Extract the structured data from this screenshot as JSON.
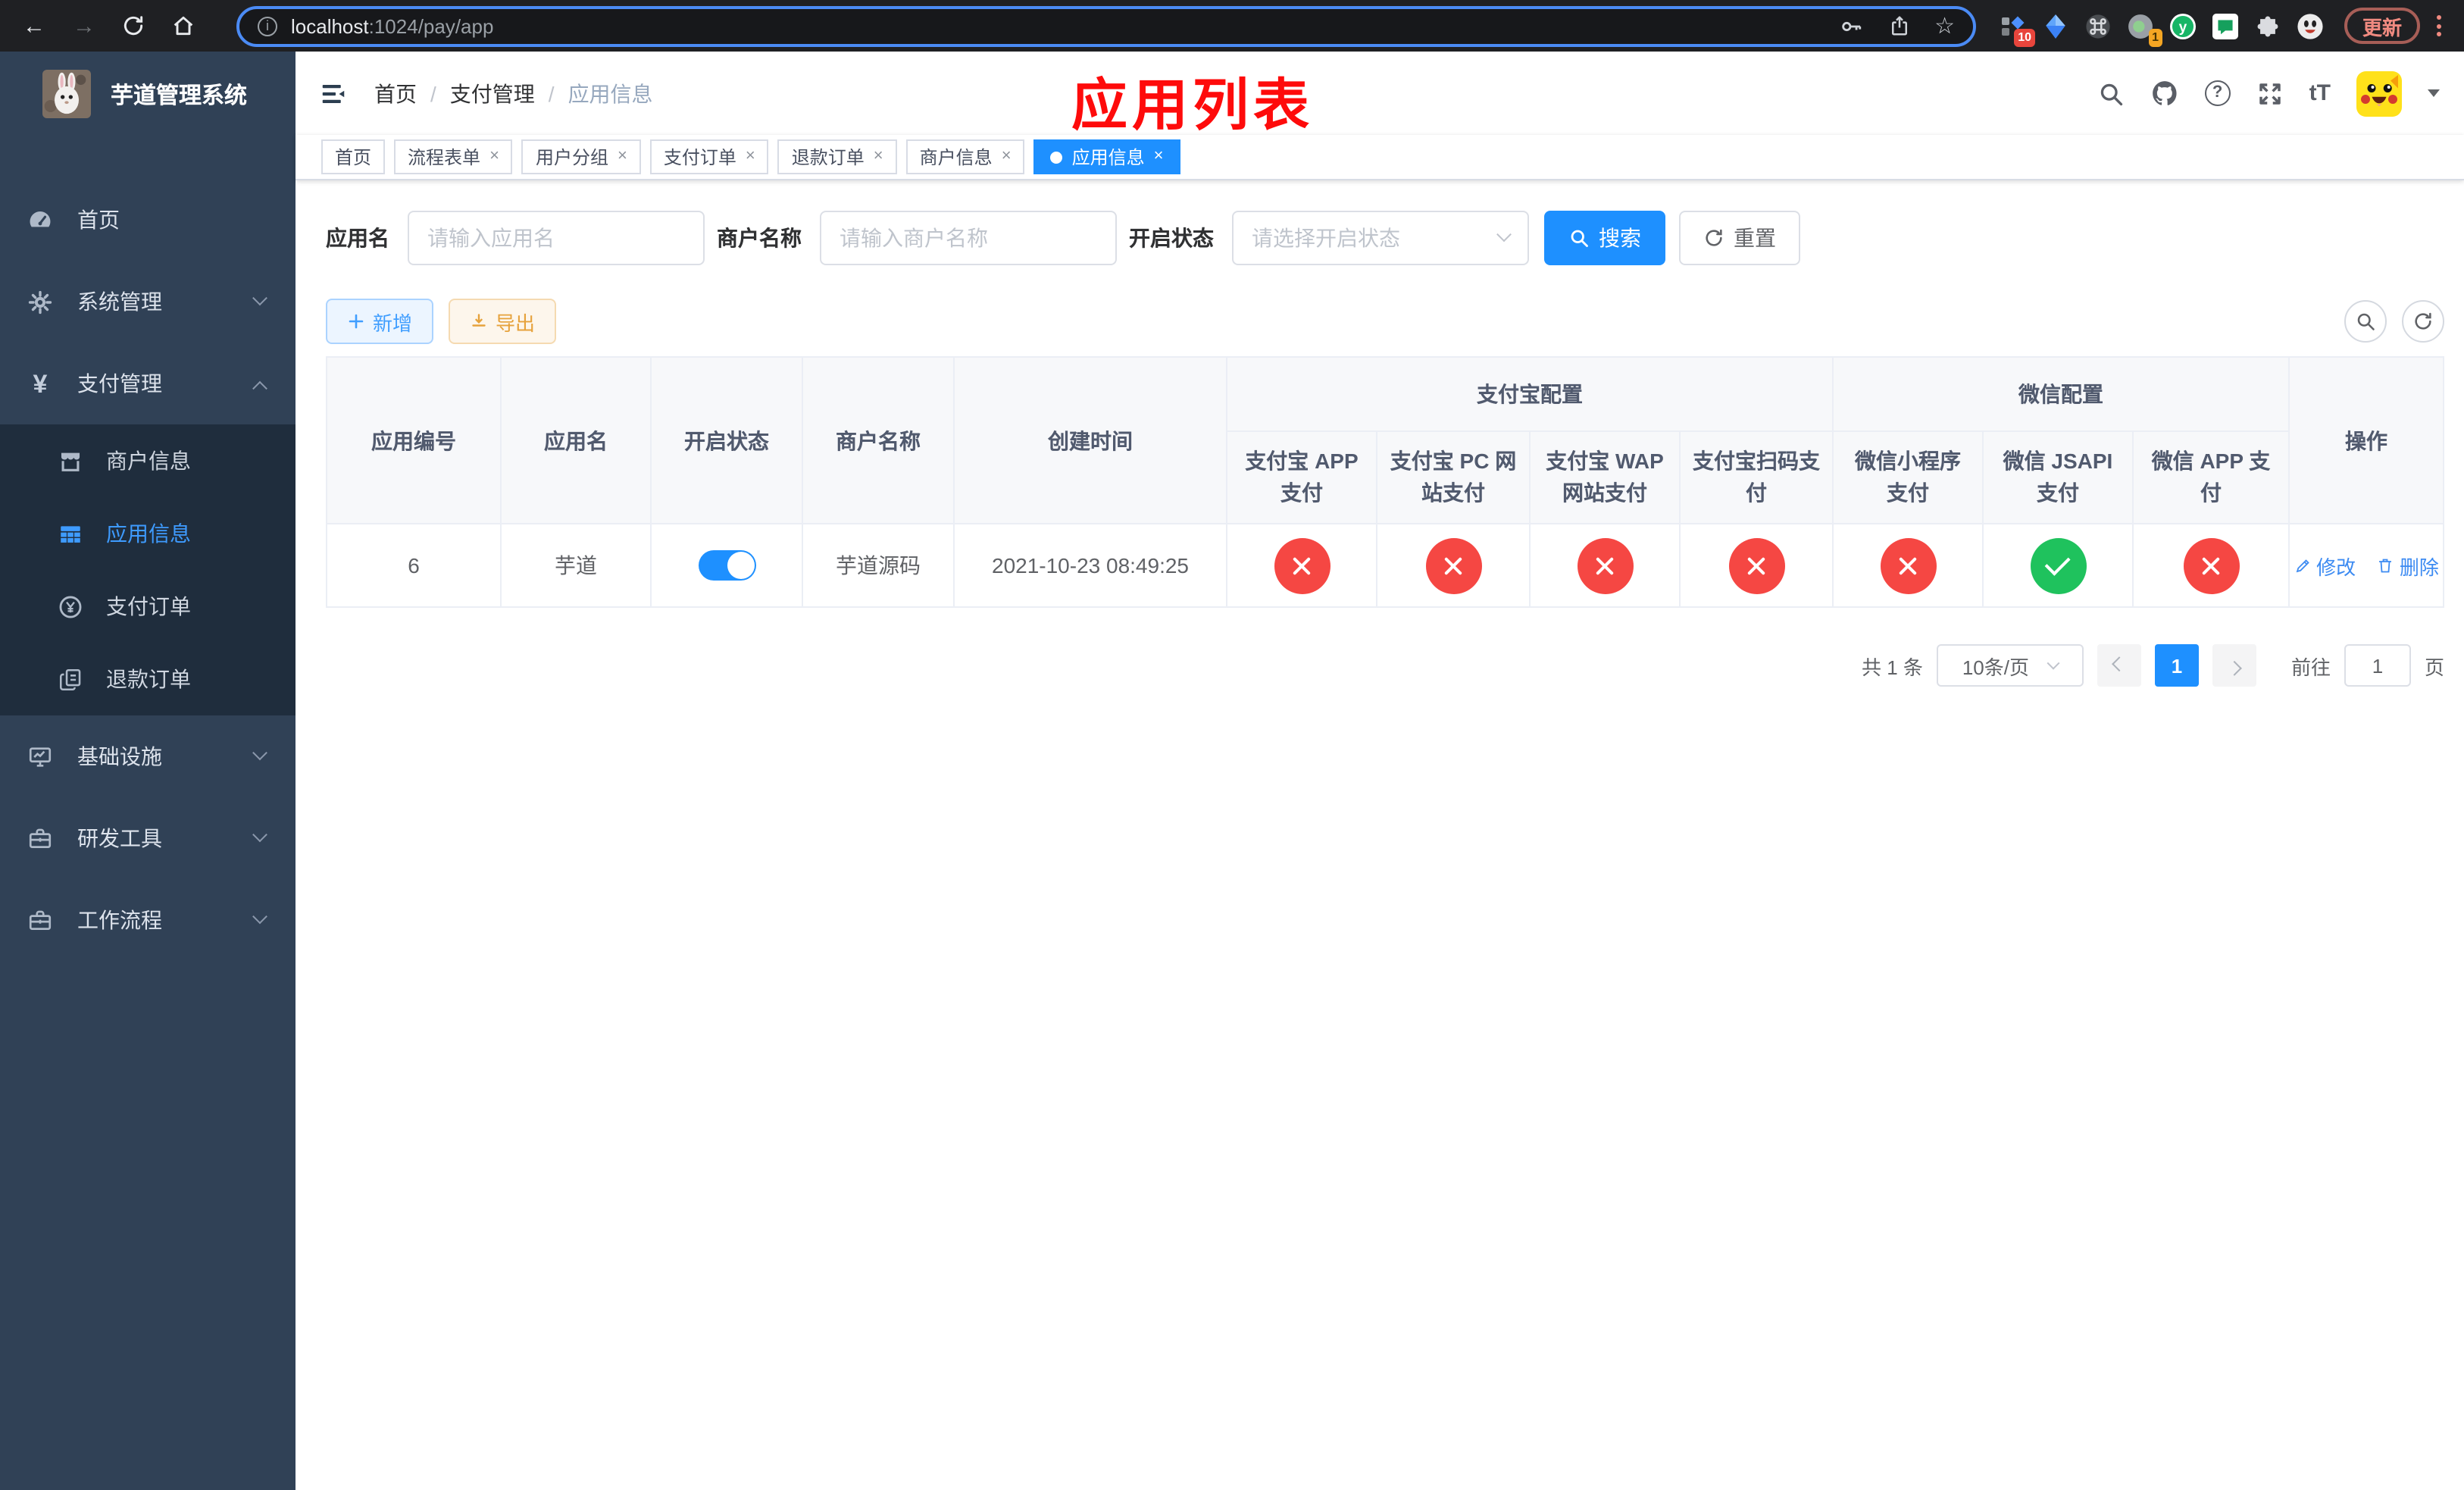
{
  "colors": {
    "accent_blue": "#1e90ff",
    "danger_red": "#f54743",
    "success_green": "#1fc25d",
    "annotation_red": "#fe0b0b",
    "sidebar_bg": "#304156",
    "submenu_bg": "#1f2d3d"
  },
  "browser": {
    "url": {
      "host": "localhost",
      "path": ":1024/pay/app"
    },
    "ext_badge_tasks": "10",
    "ext_badge_one": "1",
    "ext_y_label": "y",
    "update_label": "更新"
  },
  "sidebar": {
    "title": "芋道管理系统",
    "menu": [
      {
        "label": "首页"
      },
      {
        "label": "系统管理"
      },
      {
        "label": "支付管理"
      },
      {
        "label": "基础设施"
      },
      {
        "label": "研发工具"
      },
      {
        "label": "工作流程"
      }
    ],
    "submenu": [
      {
        "label": "商户信息"
      },
      {
        "label": "应用信息"
      },
      {
        "label": "支付订单"
      },
      {
        "label": "退款订单"
      }
    ]
  },
  "header": {
    "breadcrumb": [
      "首页",
      "支付管理",
      "应用信息"
    ],
    "annotation": "应用列表",
    "font_size_icon": "tT",
    "help_glyph": "?",
    "info_glyph": "i"
  },
  "tabs": [
    {
      "label": "首页"
    },
    {
      "label": "流程表单"
    },
    {
      "label": "用户分组"
    },
    {
      "label": "支付订单"
    },
    {
      "label": "退款订单"
    },
    {
      "label": "商户信息"
    },
    {
      "label": "应用信息"
    }
  ],
  "glyphs": {
    "close": "×",
    "star": "☆",
    "back": "←",
    "forward": "→"
  },
  "filters": {
    "app_name_label": "应用名",
    "app_name_placeholder": "请输入应用名",
    "merchant_label": "商户名称",
    "merchant_placeholder": "请输入商户名称",
    "status_label": "开启状态",
    "status_placeholder": "请选择开启状态",
    "search_label": "搜索",
    "reset_label": "重置"
  },
  "toolbar": {
    "add_label": "新增",
    "export_label": "导出"
  },
  "table": {
    "headers": {
      "app_id": "应用编号",
      "app_name": "应用名",
      "status": "开启状态",
      "merchant": "商户名称",
      "created": "创建时间",
      "alipay_group": "支付宝配置",
      "wechat_group": "微信配置",
      "pay_cols": [
        "支付宝 APP 支付",
        "支付宝 PC 网站支付",
        "支付宝 WAP 网站支付",
        "支付宝扫码支付",
        "微信小程序支付",
        "微信 JSAPI 支付",
        "微信 APP 支付"
      ],
      "actions": "操作"
    },
    "row": {
      "id": "6",
      "name": "芋道",
      "switch": "on",
      "merchant": "芋道源码",
      "created_at": "2021-10-23 08:49:25",
      "pay_states": [
        "off",
        "off",
        "off",
        "off",
        "off",
        "on",
        "off"
      ],
      "edit_label": "修改",
      "delete_label": "删除"
    }
  },
  "pagination": {
    "total": "共 1 条",
    "size": "10条/页",
    "page": "1",
    "goto_label": "前往",
    "goto_value": "1",
    "unit_label": "页"
  }
}
